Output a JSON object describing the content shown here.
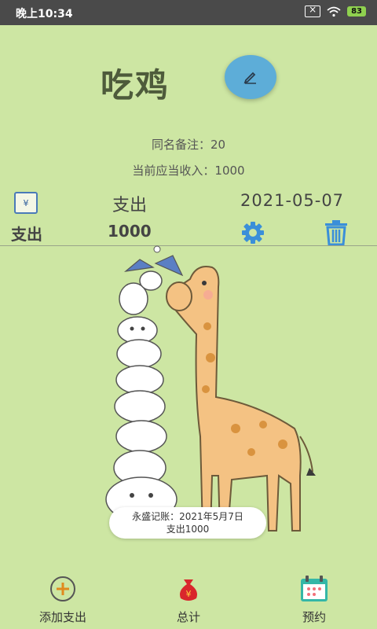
{
  "status": {
    "time": "晚上10:34",
    "battery": "83"
  },
  "header": {
    "title": "吃鸡"
  },
  "info": {
    "same_name_note": "同名备注：20",
    "receivable": "当前应当收入：1000"
  },
  "record": {
    "type": "支出",
    "date": "2021-05-07",
    "label": "支出",
    "amount": "1000"
  },
  "toast": {
    "line1": "永盛记账：2021年5月7日",
    "line2": "支出1000"
  },
  "bottom_nav": [
    {
      "label": "添加支出",
      "icon": "add-circle-icon"
    },
    {
      "label": "总计",
      "icon": "money-bag-icon"
    },
    {
      "label": "预约",
      "icon": "calendar-icon"
    }
  ]
}
